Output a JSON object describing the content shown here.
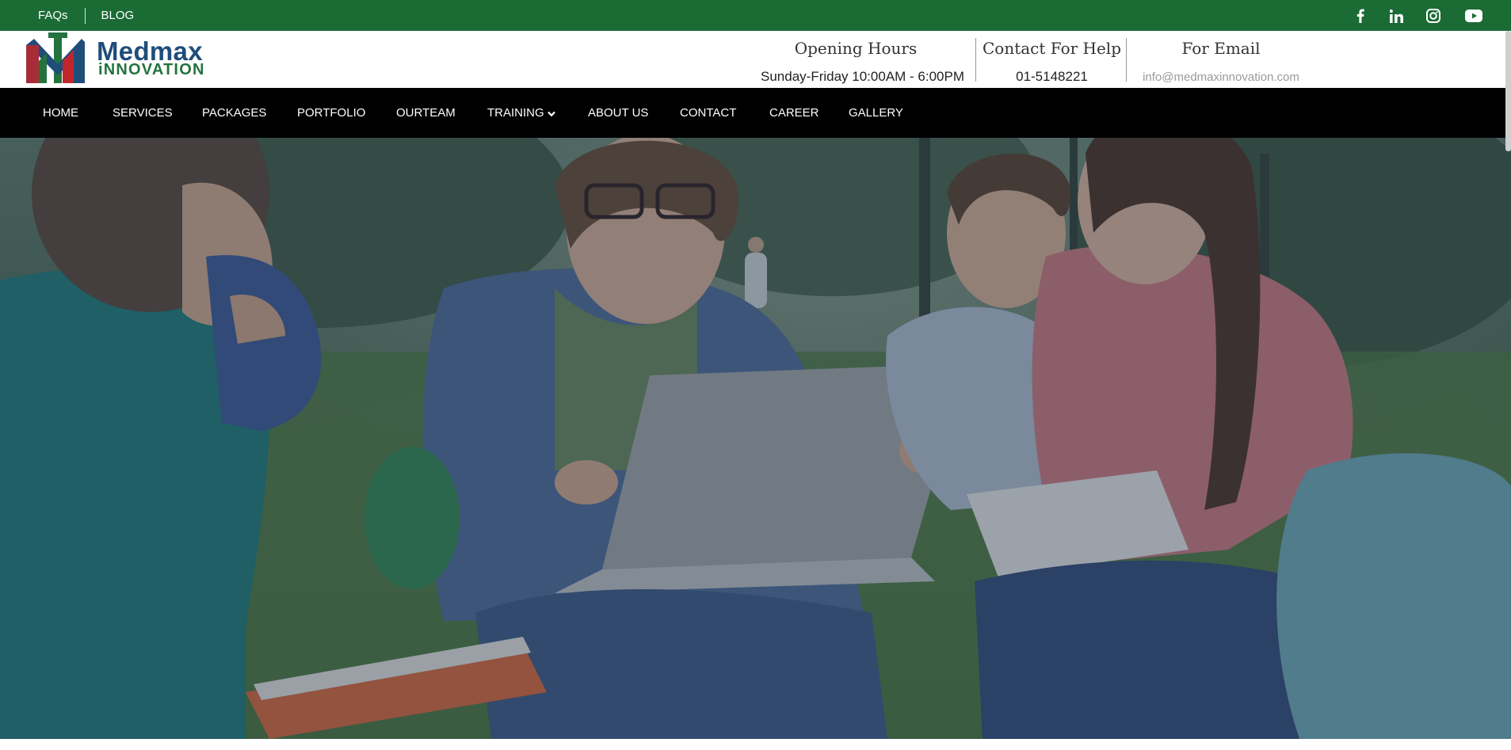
{
  "topbar": {
    "links": [
      "FAQs",
      "BLOG"
    ],
    "social_icons": [
      "facebook-icon",
      "linkedin-icon",
      "instagram-icon",
      "youtube-icon"
    ]
  },
  "brand": {
    "name_line1": "Medmax",
    "name_line2": "iNNOVATION",
    "logo_monogram": "MI"
  },
  "header_info": {
    "opening_hours": {
      "title": "Opening Hours",
      "value": "Sunday-Friday 10:00AM - 6:00PM"
    },
    "contact": {
      "title": "Contact For Help",
      "value": "01-5148221"
    },
    "email": {
      "title": "For Email",
      "value": "info@medmaxinnovation.com"
    }
  },
  "nav": {
    "items": [
      "HOME",
      "SERVICES",
      "PACKAGES",
      "PORTFOLIO",
      "OURTEAM",
      "TRAINING",
      "ABOUT US",
      "CONTACT",
      "CAREER",
      "GALLERY"
    ]
  },
  "colors": {
    "topbar": "#1b6b35",
    "nav": "#000000",
    "brand_blue": "#1f4d7a",
    "brand_green": "#24733f",
    "logo_red": "#c0272d"
  },
  "hero": {
    "image": "students-with-laptop-in-park-photo"
  }
}
